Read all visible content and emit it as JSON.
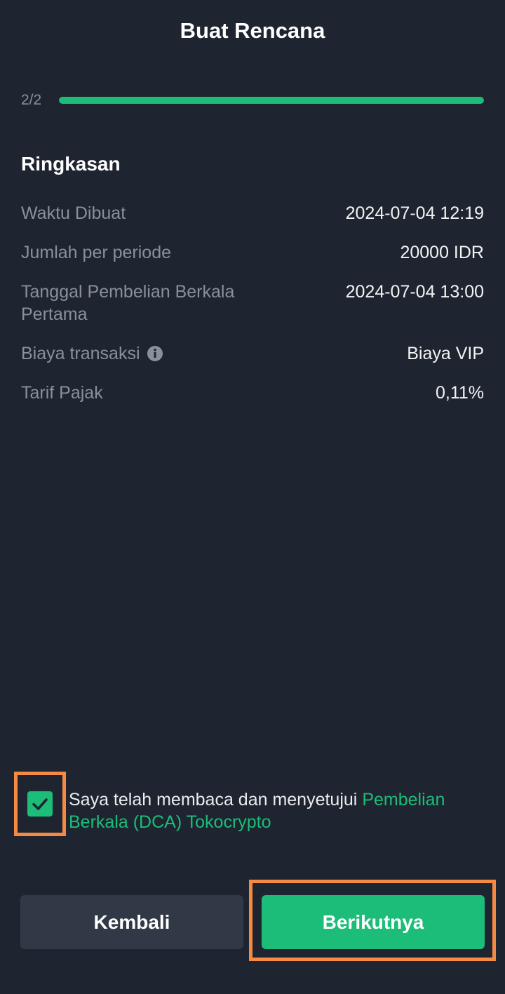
{
  "header": {
    "title": "Buat Rencana"
  },
  "progress": {
    "step_label": "2/2",
    "fraction": 1.0
  },
  "summary": {
    "title": "Ringkasan",
    "rows": [
      {
        "label": "Waktu Dibuat",
        "value": "2024-07-04 12:19"
      },
      {
        "label": "Jumlah per periode",
        "value": "20000 IDR"
      },
      {
        "label": "Tanggal Pembelian Berkala Pertama",
        "value": "2024-07-04 13:00"
      },
      {
        "label": "Biaya transaksi",
        "value": "Biaya VIP",
        "icon": "info-icon"
      },
      {
        "label": "Tarif Pajak",
        "value": "0,11%"
      }
    ]
  },
  "agreement": {
    "checked": true,
    "text": "Saya telah membaca dan menyetujui ",
    "link_text": "Pembelian Berkala (DCA) Tokocrypto"
  },
  "buttons": {
    "back_label": "Kembali",
    "next_label": "Berikutnya"
  },
  "colors": {
    "background": "#1f2530",
    "accent": "#1bbd79",
    "highlight": "#f58a42",
    "secondary_button": "#323946"
  }
}
